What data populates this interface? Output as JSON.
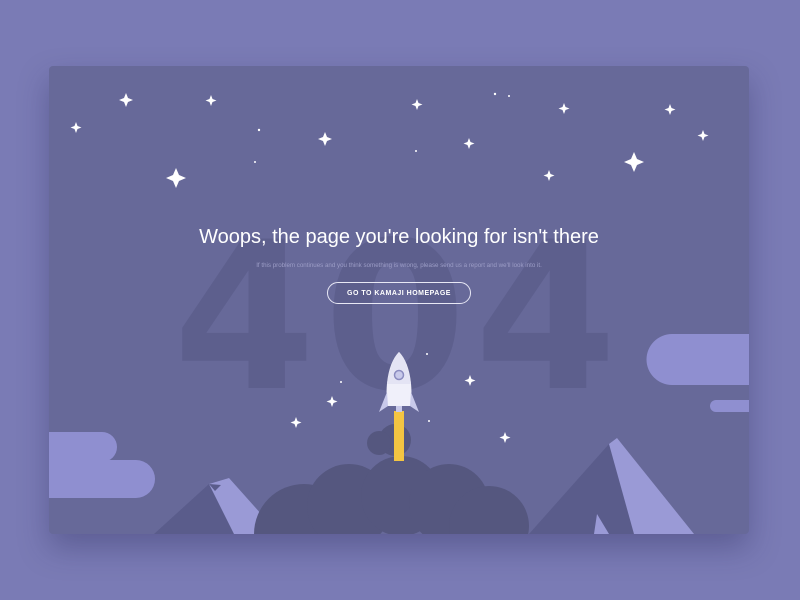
{
  "error": {
    "code": "404",
    "headline": "Woops, the page you're looking for isn't there",
    "subtext": "If this problem continues and you think something is wrong, please send us a report and we'll look into it.",
    "home_button_label": "GO TO KAMAJI HOMEPAGE"
  },
  "colors": {
    "page_background": "#7a7bb5",
    "card_background": "#676999",
    "digits": "#5d5f8d",
    "cloud": "#8f8fd0",
    "mountain": "#9a9ad6",
    "mountain_shadow": "#5a5c8b",
    "smoke": "#55577f",
    "rocket_body": "#f0f0fa",
    "rocket_flame": "#f4c542"
  },
  "icons": {
    "rocket": "rocket-icon",
    "stars": "sparkle-star-icon"
  }
}
